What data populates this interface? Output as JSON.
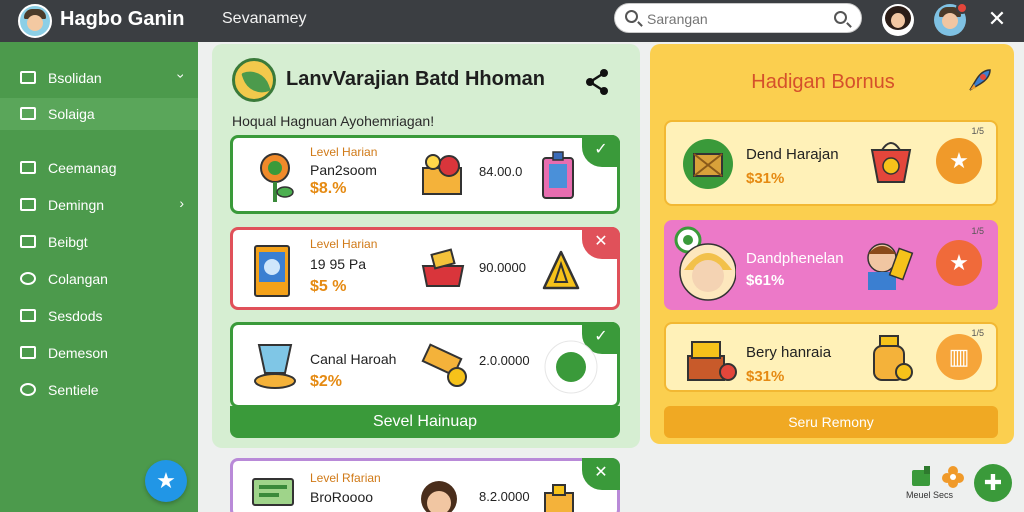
{
  "app": {
    "title": "Hagbo Ganin",
    "subtitle": "Sevanamey"
  },
  "search": {
    "placeholder": "Sarangan"
  },
  "sidebar": {
    "section_label": "",
    "items": [
      {
        "label": "Bsolidan",
        "icon": "sliders-icon",
        "chevron": "›"
      },
      {
        "label": "Solaiga",
        "icon": "window-icon"
      },
      {
        "label": "Ceemanag",
        "icon": "window-icon"
      },
      {
        "label": "Demingn",
        "icon": "pen-icon",
        "chevron": "›"
      },
      {
        "label": "Beibgt",
        "icon": "clipboard-icon"
      },
      {
        "label": "Colangan",
        "icon": "gear-icon"
      },
      {
        "label": "Sesdods",
        "icon": "arrows-icon"
      },
      {
        "label": "Demeson",
        "icon": "document-icon"
      },
      {
        "label": "Sentiele",
        "icon": "clock-icon"
      }
    ]
  },
  "main": {
    "title": "LanvVarajian Batd Hhoman",
    "subtitle": "Hoqual Hagnuan Ayohemriagan!",
    "cards": [
      {
        "level": "Level Harian",
        "name": "Pan2soom",
        "percent": "$8.%",
        "value": "84.00.0",
        "status": "✓"
      },
      {
        "level": "Level Harian",
        "name": "19 95 Pa",
        "percent": "$5 %",
        "value": "90.0000",
        "status": "✕"
      },
      {
        "level": "",
        "name": "Canal Haroah",
        "percent": "$2%",
        "value": "2.0.0000",
        "status": "✓"
      },
      {
        "level": "Level Rfarian",
        "name": "BroRoooo",
        "percent": "",
        "value": "8.2.0000",
        "status": "✕"
      }
    ],
    "action_label": "Sevel Hainuap"
  },
  "bonus": {
    "title": "Hadigan Bornus",
    "cards": [
      {
        "name": "Dend Harajan",
        "percent": "$31%",
        "count": "1/5"
      },
      {
        "name": "Dandphenelan",
        "percent": "$61%",
        "count": "1/5"
      },
      {
        "name": "Bery hanraia",
        "percent": "$31%",
        "count": "1/5"
      }
    ],
    "action_label": "Seru Remony"
  },
  "footer": {
    "label": "Meuel Secs"
  },
  "colors": {
    "topbar": "#3b3e42",
    "sidebar": "#4c9a4c",
    "panel_green": "#d6eed2",
    "panel_yellow": "#fbcf4f",
    "accent_orange": "#f09a2a",
    "accent_red": "#e0515a",
    "accent_blue": "#2196e6"
  }
}
